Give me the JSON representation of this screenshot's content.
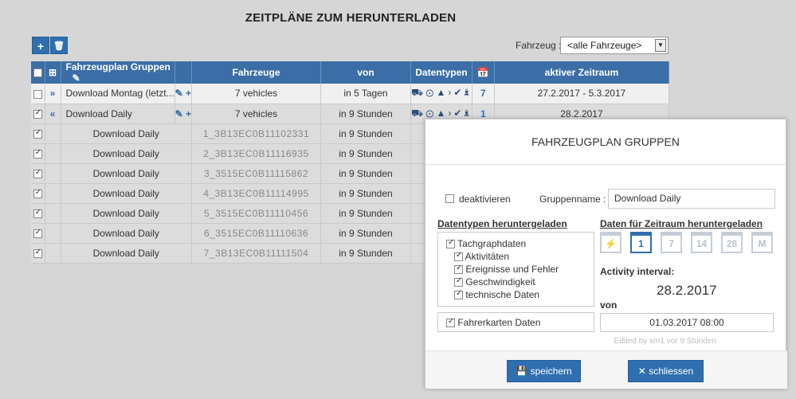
{
  "page": {
    "title": "ZEITPLÄNE ZUM HERUNTERLADEN"
  },
  "toolbar": {
    "add_icon": "plus-icon",
    "delete_icon": "trash-icon",
    "vehicle_label": "Fahrzeug :",
    "vehicle_value": "<alle Fahrzeuge>"
  },
  "table": {
    "headers": {
      "name": "Fahrzeugplan Gruppen",
      "vehicles": "Fahrzeuge",
      "from": "von",
      "datatypes": "Datentypen",
      "active": "aktiver Zeitraum"
    },
    "groups": [
      {
        "name": "Download Montag (letzt...",
        "vehicles": "7 vehicles",
        "from": "in 5 Tagen",
        "cal_day": "7",
        "active": "27.2.2017 - 5.3.2017",
        "checked": false,
        "expanded": false
      },
      {
        "name": "Download Daily",
        "vehicles": "7 vehicles",
        "from": "in 9 Stunden",
        "cal_day": "1",
        "active": "28.2.2017",
        "checked": true,
        "expanded": true
      }
    ],
    "children": [
      {
        "name": "Download Daily",
        "vehicle": "1_3B13EC0B11102331",
        "from": "in 9 Stunden"
      },
      {
        "name": "Download Daily",
        "vehicle": "2_3B13EC0B11116935",
        "from": "in 9 Stunden"
      },
      {
        "name": "Download Daily",
        "vehicle": "3_3515EC0B11115862",
        "from": "in 9 Stunden"
      },
      {
        "name": "Download Daily",
        "vehicle": "4_3B13EC0B11114995",
        "from": "in 9 Stunden"
      },
      {
        "name": "Download Daily",
        "vehicle": "5_3515EC0B11110456",
        "from": "in 9 Stunden"
      },
      {
        "name": "Download Daily",
        "vehicle": "6_3515EC0B11110636",
        "from": "in 9 Stunden"
      },
      {
        "name": "Download Daily",
        "vehicle": "7_3B13EC0B11111504",
        "from": "in 9 Stunden"
      }
    ]
  },
  "modal": {
    "title": "FAHRZEUGPLAN GRUPPEN",
    "deactivate_label": "deaktivieren",
    "group_name_label": "Gruppenname :",
    "group_name_value": "Download Daily",
    "datatypes_heading": "Datentypen heruntergeladen",
    "period_heading": "Daten für Zeitraum heruntergeladen",
    "tacho": "Tachgraphdaten",
    "activities": "Aktivitäten",
    "events": "Ereignisse und Fehler",
    "speed": "Geschwindigkeit",
    "technical": "technische Daten",
    "driver_cards": "Fahrerkarten Daten",
    "cal_labels": [
      "⚡",
      "1",
      "7",
      "14",
      "28",
      "M"
    ],
    "interval_label": "Activity interval:",
    "interval_value": "28.2.2017",
    "from_label": "von",
    "from_value": "01.03.2017 08:00",
    "edited_by": "Edited by   sm1 vor 9 Stunden",
    "save_label": "speichern",
    "close_label": "schliessen"
  }
}
